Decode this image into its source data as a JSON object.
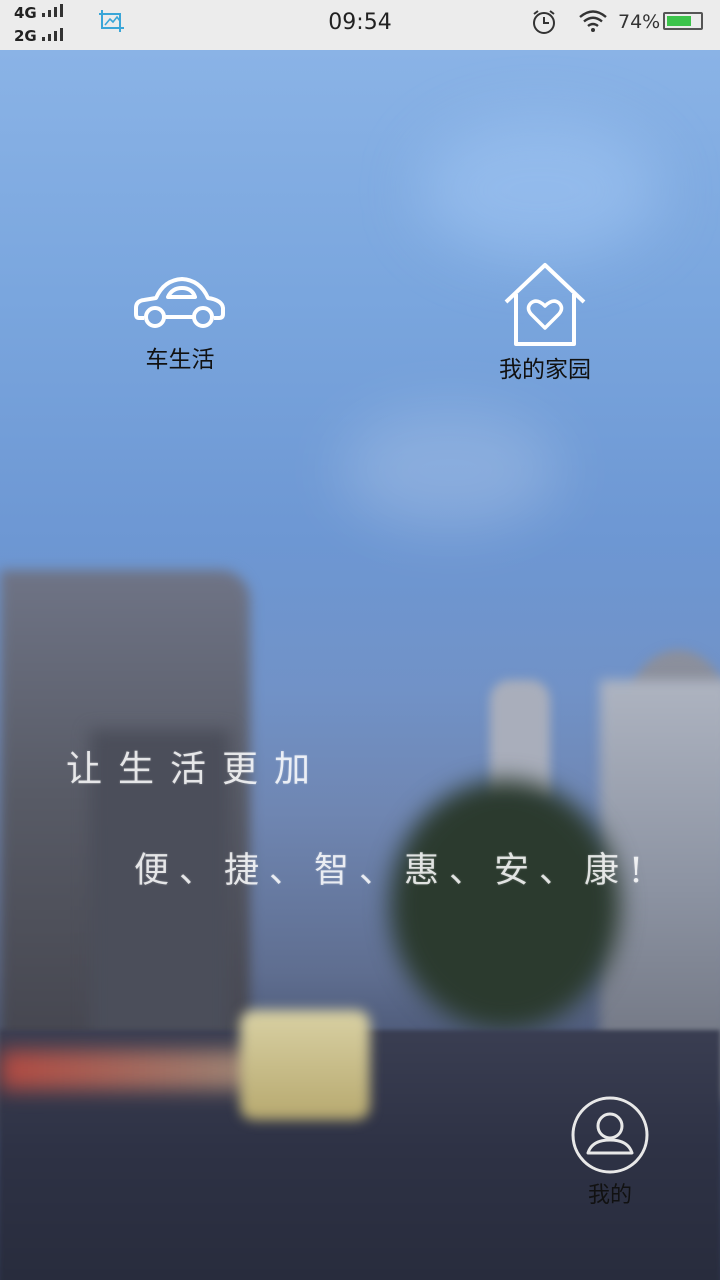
{
  "status_bar": {
    "network_top": "4G",
    "network_bottom": "2G",
    "time": "09:54",
    "battery_percent": "74%",
    "battery_level": 0.74,
    "icons": [
      "signal-icon",
      "screenshot-crop-icon",
      "alarm-icon",
      "wifi-icon",
      "battery-icon"
    ]
  },
  "features": {
    "car": {
      "label": "车生活",
      "icon": "car-icon"
    },
    "home": {
      "label": "我的家园",
      "icon": "home-heart-icon"
    }
  },
  "slogan": {
    "line1": "让生活更加",
    "line2": "便、捷、智、惠、安、康!"
  },
  "profile": {
    "label": "我的",
    "icon": "user-icon"
  },
  "colors": {
    "icon_white": "#ffffff",
    "status_bar_bg": "#ececec",
    "battery_green": "#3cc34b",
    "crop_icon": "#3aa6d8"
  }
}
